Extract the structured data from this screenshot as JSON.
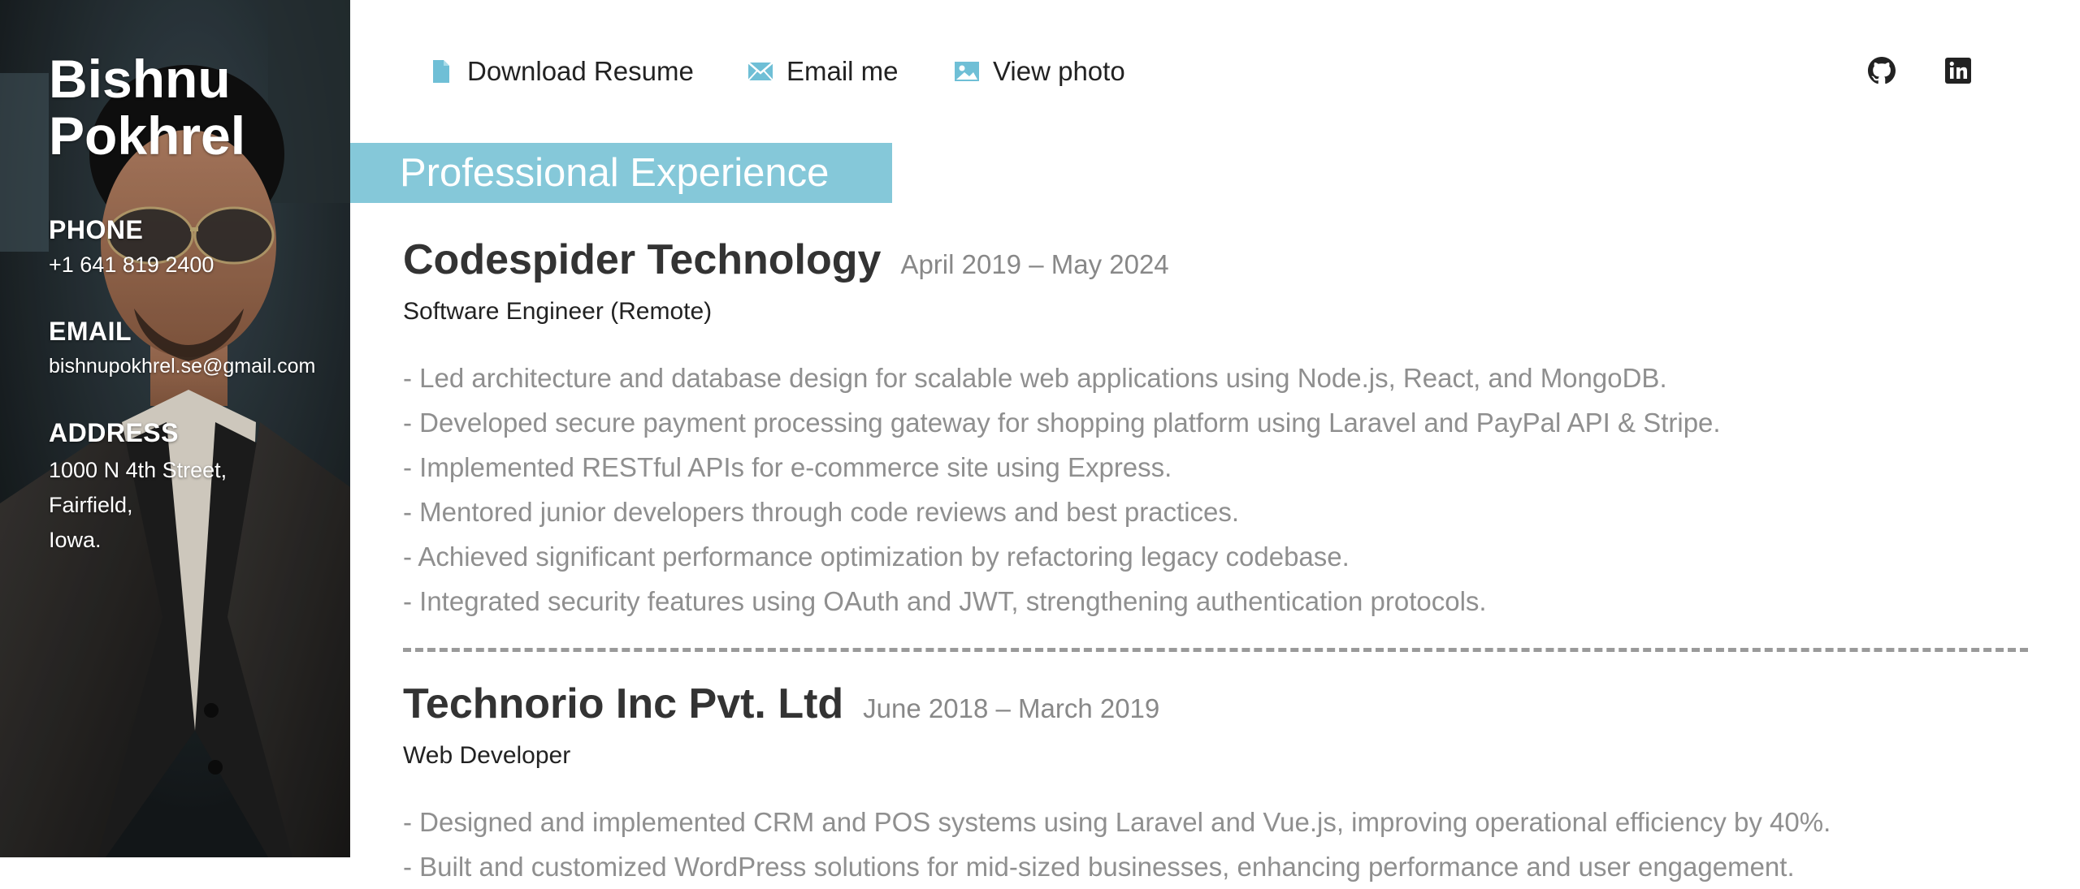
{
  "profile": {
    "name_line1": "Bishnu",
    "name_line2": "Pokhrel",
    "phone_label": "PHONE",
    "phone": "+1 641 819 2400",
    "email_label": "EMAIL",
    "email": "bishnupokhrel.se@gmail.com",
    "address_label": "ADDRESS",
    "address_lines": [
      "1000 N 4th Street,",
      "Fairfield,",
      "Iowa."
    ]
  },
  "nav": {
    "download_resume": "Download Resume",
    "email_me": "Email me",
    "view_photo": "View photo",
    "icons": {
      "download": "document-icon",
      "email": "envelope-icon",
      "photo": "image-icon",
      "github": "github-icon",
      "linkedin": "linkedin-icon"
    }
  },
  "section": {
    "title": "Professional Experience"
  },
  "jobs": [
    {
      "company": "Codespider Technology",
      "dates": "April 2019 – May 2024",
      "role": "Software Engineer (Remote)",
      "bullets": [
        "- Led architecture and database design for scalable web applications using Node.js, React, and MongoDB.",
        "- Developed secure payment processing gateway for shopping platform using Laravel and PayPal API & Stripe.",
        "- Implemented RESTful APIs for e-commerce site using Express.",
        "- Mentored junior developers through code reviews and best practices.",
        "- Achieved significant performance optimization by refactoring legacy codebase.",
        "- Integrated security features using OAuth and JWT, strengthening authentication protocols."
      ]
    },
    {
      "company": "Technorio Inc Pvt. Ltd",
      "dates": "June 2018 – March 2019",
      "role": "Web Developer",
      "bullets": [
        "- Designed and implemented CRM and POS systems using Laravel and Vue.js, improving operational efficiency by 40%.",
        "- Built and customized WordPress solutions for mid-sized businesses, enhancing performance and user engagement."
      ]
    }
  ],
  "colors": {
    "accent": "#85c8d9",
    "icon_accent": "#6fbfd6",
    "text_dark": "#333333",
    "text_muted": "#8f8f8f",
    "divider": "#9a9a9a"
  }
}
